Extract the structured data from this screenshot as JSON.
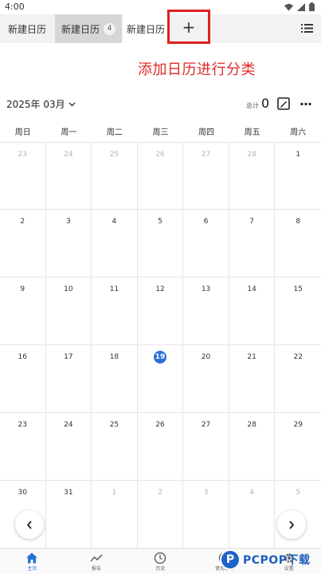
{
  "status_bar": {
    "time": "4:00",
    "icons": [
      "wifi-icon",
      "signal-icon",
      "battery-icon"
    ]
  },
  "tabs": [
    {
      "label": "新建日历",
      "badge": ""
    },
    {
      "label": "新建日历",
      "badge": "4"
    },
    {
      "label": "新建日历",
      "badge": ""
    }
  ],
  "tab_add_label": "+",
  "annotation": "添加日历进行分类",
  "calendar": {
    "month_label": "2025年 03月",
    "total_label": "总计",
    "total_value": "0",
    "weekdays": [
      "周日",
      "周一",
      "周二",
      "周三",
      "周四",
      "周五",
      "周六"
    ],
    "today": "19",
    "days": [
      {
        "n": "23",
        "m": true
      },
      {
        "n": "24",
        "m": true
      },
      {
        "n": "25",
        "m": true
      },
      {
        "n": "26",
        "m": true
      },
      {
        "n": "27",
        "m": true
      },
      {
        "n": "28",
        "m": true
      },
      {
        "n": "1",
        "m": false
      },
      {
        "n": "2",
        "m": false
      },
      {
        "n": "3",
        "m": false
      },
      {
        "n": "4",
        "m": false
      },
      {
        "n": "5",
        "m": false
      },
      {
        "n": "6",
        "m": false
      },
      {
        "n": "7",
        "m": false
      },
      {
        "n": "8",
        "m": false
      },
      {
        "n": "9",
        "m": false
      },
      {
        "n": "10",
        "m": false
      },
      {
        "n": "11",
        "m": false
      },
      {
        "n": "12",
        "m": false
      },
      {
        "n": "13",
        "m": false
      },
      {
        "n": "14",
        "m": false
      },
      {
        "n": "15",
        "m": false
      },
      {
        "n": "16",
        "m": false
      },
      {
        "n": "17",
        "m": false
      },
      {
        "n": "18",
        "m": false
      },
      {
        "n": "19",
        "m": false
      },
      {
        "n": "20",
        "m": false
      },
      {
        "n": "21",
        "m": false
      },
      {
        "n": "22",
        "m": false
      },
      {
        "n": "23",
        "m": false
      },
      {
        "n": "24",
        "m": false
      },
      {
        "n": "25",
        "m": false
      },
      {
        "n": "26",
        "m": false
      },
      {
        "n": "27",
        "m": false
      },
      {
        "n": "28",
        "m": false
      },
      {
        "n": "29",
        "m": false
      },
      {
        "n": "30",
        "m": false
      },
      {
        "n": "31",
        "m": false
      },
      {
        "n": "1",
        "m": true
      },
      {
        "n": "2",
        "m": true
      },
      {
        "n": "3",
        "m": true
      },
      {
        "n": "4",
        "m": true
      },
      {
        "n": "5",
        "m": true
      }
    ]
  },
  "bottom_nav": [
    {
      "label": "主页",
      "icon": "home-icon",
      "active": true
    },
    {
      "label": "报告",
      "icon": "trend-icon",
      "active": false
    },
    {
      "label": "历史",
      "icon": "clock-icon",
      "active": false
    },
    {
      "label": "使用说明",
      "icon": "help-icon",
      "active": false
    },
    {
      "label": "设置",
      "icon": "gear-icon",
      "active": false
    }
  ],
  "watermark": {
    "logo_letter": "P",
    "text": "PCPOP下载"
  },
  "colors": {
    "accent": "#2a6fd6",
    "annotation": "#e02b2b",
    "highlight_box": "#e02020"
  }
}
